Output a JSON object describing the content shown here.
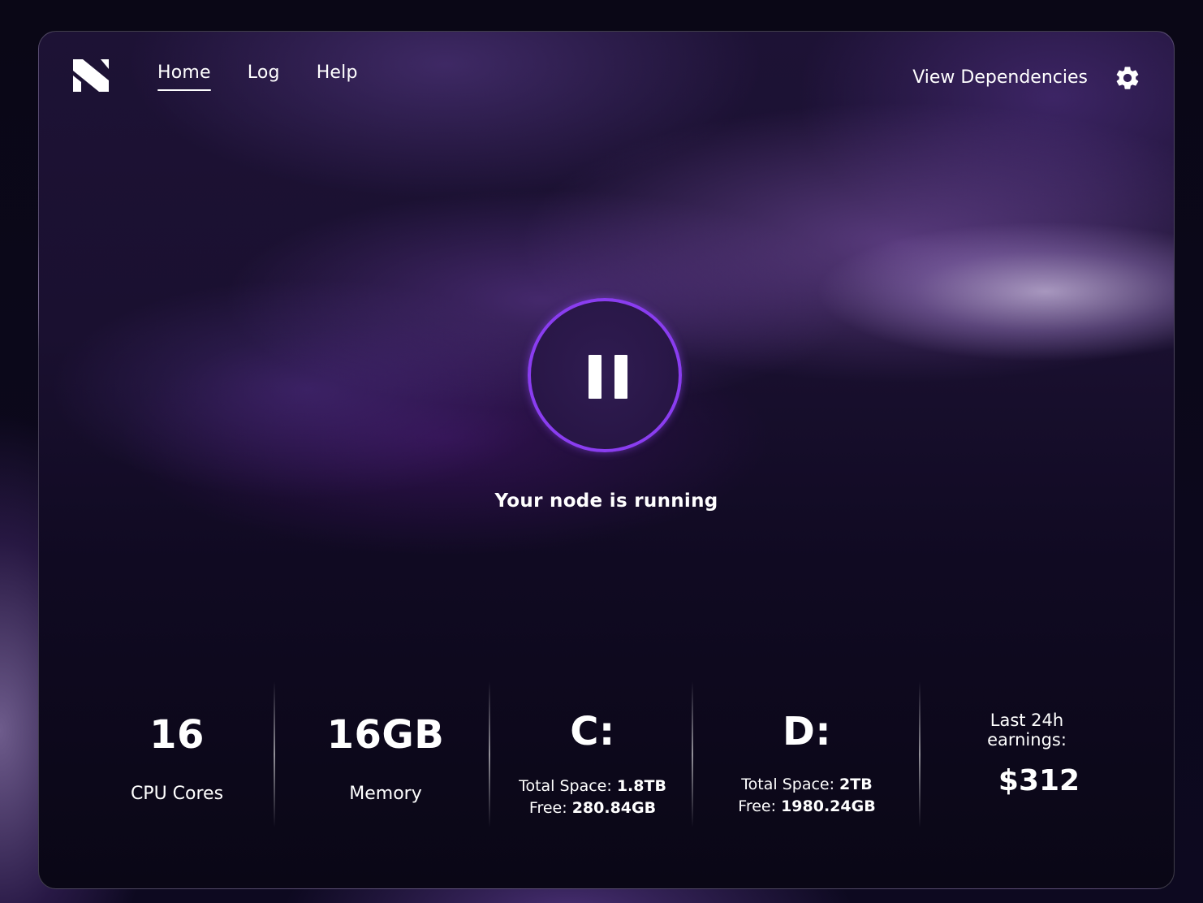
{
  "nav": {
    "items": [
      {
        "label": "Home",
        "active": true
      },
      {
        "label": "Log",
        "active": false
      },
      {
        "label": "Help",
        "active": false
      }
    ],
    "view_dependencies": "View Dependencies",
    "settings_icon": "gear-icon",
    "logo_icon": "brand-logo"
  },
  "node": {
    "control_icon": "pause-icon",
    "status": "Your node is running",
    "accent_color": "#8a3df0"
  },
  "stats": {
    "cpu": {
      "value": "16",
      "label": "CPU Cores"
    },
    "memory": {
      "value": "16GB",
      "label": "Memory"
    },
    "drive_c": {
      "name": "C:",
      "total_label": "Total Space:",
      "total_value": "1.8TB",
      "free_label": "Free:",
      "free_value": "280.84GB"
    },
    "drive_d": {
      "name": "D:",
      "total_label": "Total Space:",
      "total_value": "2TB",
      "free_label": "Free:",
      "free_value": "1980.24GB"
    },
    "earnings": {
      "label_line1": "Last 24h",
      "label_line2": "earnings:",
      "value": "$312"
    }
  }
}
